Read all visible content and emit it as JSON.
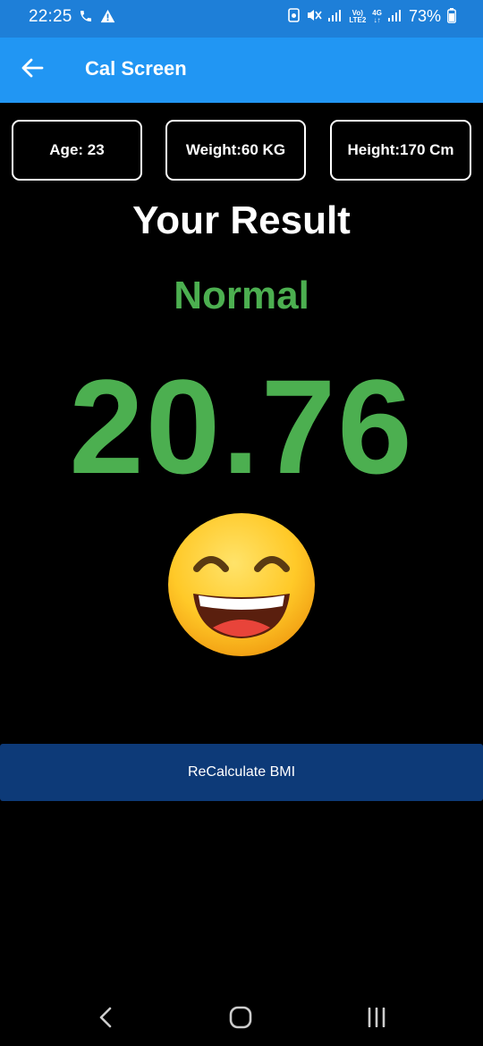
{
  "status_bar": {
    "time": "22:25",
    "battery_percent": "73%",
    "network_label_top": "Vo)",
    "network_label_bottom": "LTE2",
    "network_type": "4G",
    "icons": [
      "phone-icon",
      "warning-icon",
      "sim-icon",
      "mute-icon",
      "signal-icon",
      "signal-icon",
      "battery-icon"
    ]
  },
  "app_bar": {
    "title": "Cal Screen",
    "back_icon": "arrow-left-icon"
  },
  "info": {
    "age": "Age: 23",
    "weight": "Weight:60 KG",
    "height": "Height:170 Cm"
  },
  "result": {
    "heading": "Your Result",
    "category": "Normal",
    "bmi": "20.76",
    "emoji": "grinning-face-icon"
  },
  "actions": {
    "recalculate_label": "ReCalculate BMI"
  },
  "colors": {
    "status_bar": "#1E7FD8",
    "app_bar": "#2196F3",
    "accent_green": "#4CAF50",
    "button": "#0D3A78",
    "background": "#000000"
  },
  "nav": {
    "icons": [
      "nav-back-icon",
      "nav-home-icon",
      "nav-recents-icon"
    ]
  }
}
